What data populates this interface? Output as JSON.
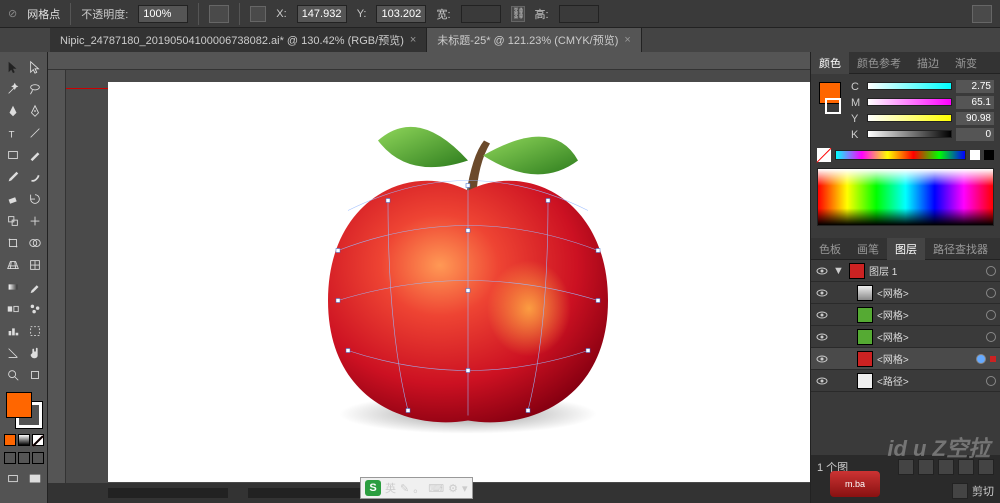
{
  "top": {
    "selection_type": "网格点",
    "opacity_label": "不透明度:",
    "opacity_value": "100%",
    "x_label": "X:",
    "x_value": "147.932",
    "y_label": "Y:",
    "y_value": "103.202",
    "w_label": "宽:",
    "w_value": "",
    "h_label": "高:",
    "h_value": ""
  },
  "tabs": [
    {
      "label": "Nipic_24787180_20190504100006738082.ai* @ 130.42% (RGB/预览)",
      "active": false
    },
    {
      "label": "未标题-25* @ 121.23% (CMYK/预览)",
      "active": true
    }
  ],
  "color_panel": {
    "tabs": [
      "颜色",
      "颜色参考",
      "描边",
      "渐变"
    ],
    "active_tab": 0,
    "channels": [
      {
        "name": "C",
        "value": "2.75"
      },
      {
        "name": "M",
        "value": "65.1"
      },
      {
        "name": "Y",
        "value": "90.98"
      },
      {
        "name": "K",
        "value": "0"
      }
    ]
  },
  "layers_panel": {
    "tabs": [
      "色板",
      "画笔",
      "图层",
      "路径查找器"
    ],
    "active_tab": 2,
    "rows": [
      {
        "name": "图层 1",
        "color": "#c00",
        "indent": 0,
        "expanded": true
      },
      {
        "name": "<网格>",
        "thumb": "#ddd",
        "indent": 1
      },
      {
        "name": "<网格>",
        "thumb": "#5a3",
        "indent": 1
      },
      {
        "name": "<网格>",
        "thumb": "#5a3",
        "indent": 1
      },
      {
        "name": "<网格>",
        "thumb": "#c22",
        "indent": 1,
        "selected": true
      },
      {
        "name": "<路径>",
        "thumb": "#eee",
        "indent": 1
      }
    ],
    "footer_count": "1 个图",
    "trim_label": "剪切"
  },
  "ime": {
    "lang": "英",
    "punct": "。",
    "tool": "⚙"
  },
  "watermark": "id u Z空拉"
}
